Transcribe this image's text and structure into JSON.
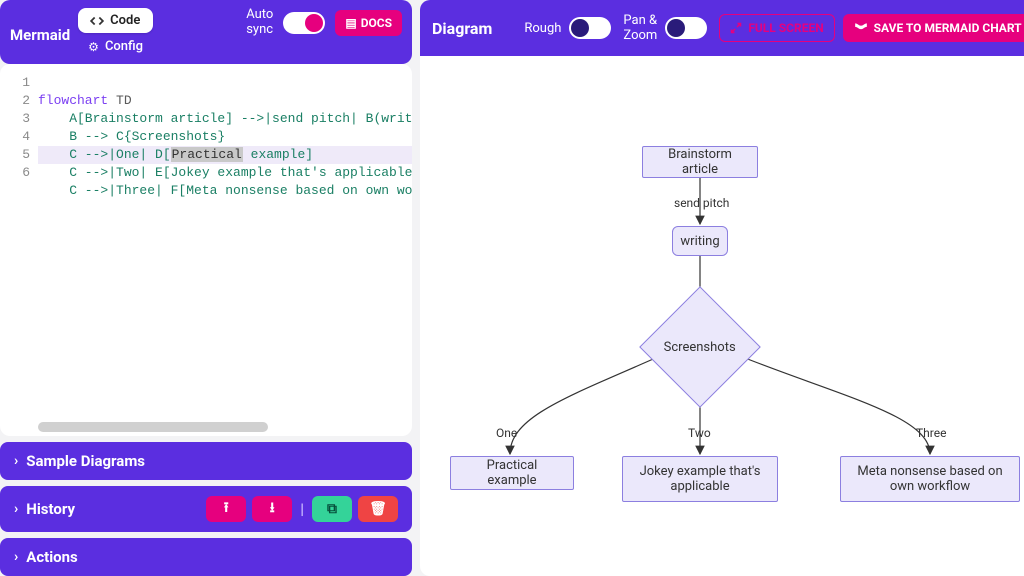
{
  "left": {
    "brand": "Mermaid",
    "tabs": {
      "code": "Code",
      "config": "Config"
    },
    "sync_label": "Auto\nsync",
    "docs": "DOCS",
    "lines": {
      "l1_kw": "flowchart",
      "l1_dir": " TD",
      "l2": "    A[Brainstorm article] -->|send pitch| B(writing)",
      "l3": "    B --> C{Screenshots}",
      "l4_pre": "    C -->|One| D[",
      "l4_sel": "Practical",
      "l4_post": " example]",
      "l5": "    C -->|Two| E[Jokey example that's applicable]",
      "l6": "    C -->|Three| F[Meta nonsense based on own workfl"
    },
    "accordions": {
      "samples": "Sample Diagrams",
      "history": "History",
      "actions": "Actions"
    }
  },
  "right": {
    "title": "Diagram",
    "rough": "Rough",
    "panzoom": "Pan &\nZoom",
    "fullscreen": "FULL SCREEN",
    "save": "SAVE TO MERMAID CHART",
    "nodes": {
      "a": "Brainstorm article",
      "b": "writing",
      "c": "Screenshots",
      "d": "Practical example",
      "e": "Jokey example that's\napplicable",
      "f": "Meta nonsense based on\nown workflow"
    },
    "edge_labels": {
      "ab": "send pitch",
      "cd": "One",
      "ce": "Two",
      "cf": "Three"
    }
  }
}
